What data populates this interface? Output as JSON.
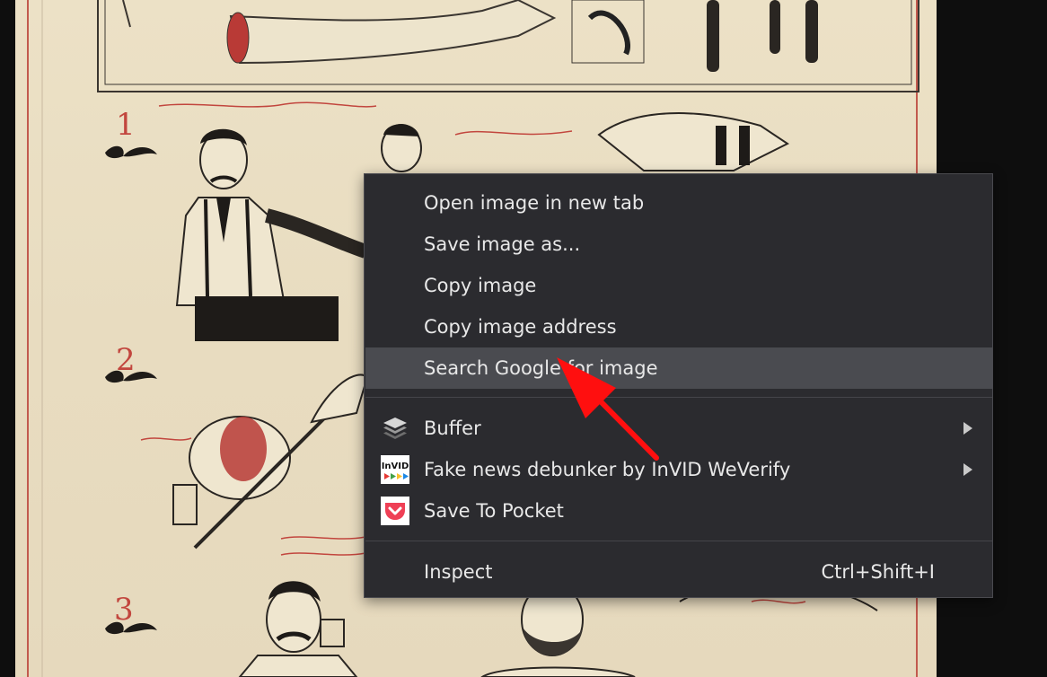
{
  "context_menu": {
    "items": [
      {
        "label": "Open image in new tab"
      },
      {
        "label": "Save image as..."
      },
      {
        "label": "Copy image"
      },
      {
        "label": "Copy image address"
      },
      {
        "label": "Search Google for image",
        "highlighted": true
      },
      {
        "label": "Buffer",
        "icon": "buffer-icon",
        "has_submenu": true
      },
      {
        "label": "Fake news debunker by InVID  WeVerify",
        "icon": "invid-icon",
        "has_submenu": true
      },
      {
        "label": "Save To Pocket",
        "icon": "pocket-icon"
      },
      {
        "label": "Inspect",
        "shortcut": "Ctrl+Shift+I"
      }
    ],
    "invid_icon_text": "InVID"
  },
  "colors": {
    "menu_bg": "#2b2b2f",
    "menu_highlight": "#4a4b50",
    "annotation_arrow": "#ff0f0f",
    "pocket": "#ef4056"
  }
}
